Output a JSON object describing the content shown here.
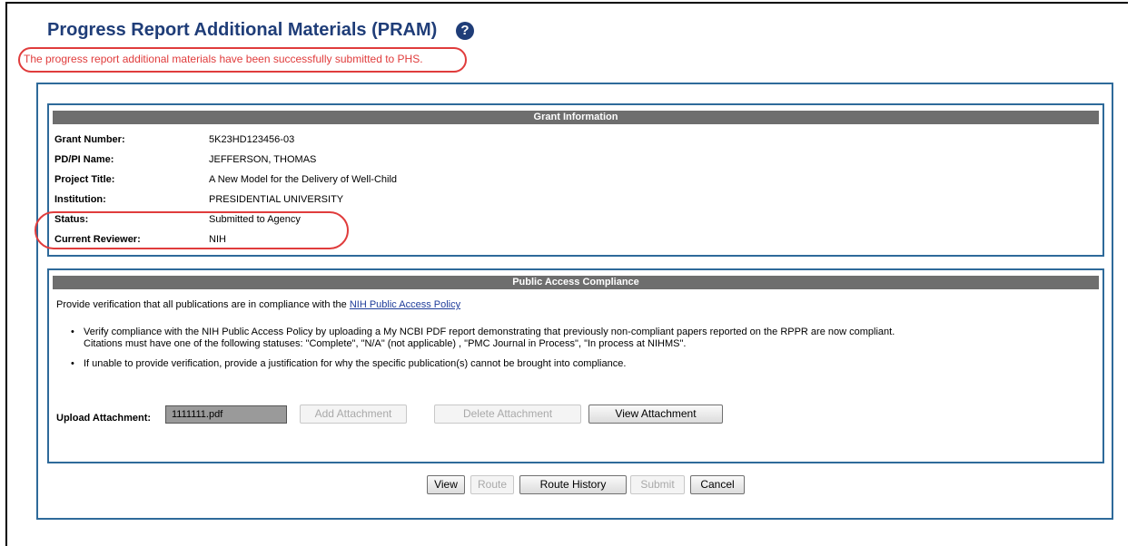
{
  "page": {
    "title": "Progress Report Additional Materials (PRAM)",
    "help_icon": "?",
    "success_message": "The progress report additional materials have been successfully submitted to PHS."
  },
  "grant_info": {
    "header": "Grant Information",
    "rows": [
      {
        "label": "Grant Number:",
        "value": "5K23HD123456-03"
      },
      {
        "label": "PD/PI Name:",
        "value": "JEFFERSON, THOMAS"
      },
      {
        "label": "Project Title:",
        "value": "A New Model for the Delivery of Well-Child"
      },
      {
        "label": "Institution:",
        "value": "PRESIDENTIAL UNIVERSITY"
      },
      {
        "label": "Status:",
        "value": "Submitted to Agency"
      },
      {
        "label": "Current Reviewer:",
        "value": "NIH"
      }
    ]
  },
  "public_access": {
    "header": "Public Access Compliance",
    "intro_text": "Provide verification that all publications are in compliance with the ",
    "policy_link": "NIH Public Access Policy",
    "bullets": [
      {
        "line1": "Verify compliance with the NIH Public Access Policy by uploading a My NCBI PDF report demonstrating that previously non-compliant papers reported on the RPPR are now compliant.",
        "line2": "Citations must have one of the following statuses: \"Complete\", \"N/A\" (not applicable) , \"PMC Journal in Process\", \"In process at NIHMS\"."
      },
      {
        "line1": "If unable to provide verification, provide a justification for why the specific publication(s) cannot be brought into compliance.",
        "line2": ""
      }
    ],
    "upload_label": "Upload Attachment:",
    "file_value": "1111111.pdf",
    "buttons": {
      "add": "Add Attachment",
      "delete": "Delete Attachment",
      "view": "View Attachment"
    }
  },
  "actions": {
    "view": "View",
    "route": "Route",
    "route_history": "Route History",
    "submit": "Submit",
    "cancel": "Cancel"
  },
  "colors": {
    "title": "#1f3d78",
    "highlight": "#e03c3c",
    "panel_border": "#2e6a9a",
    "header_bar": "#6e6e6e"
  }
}
